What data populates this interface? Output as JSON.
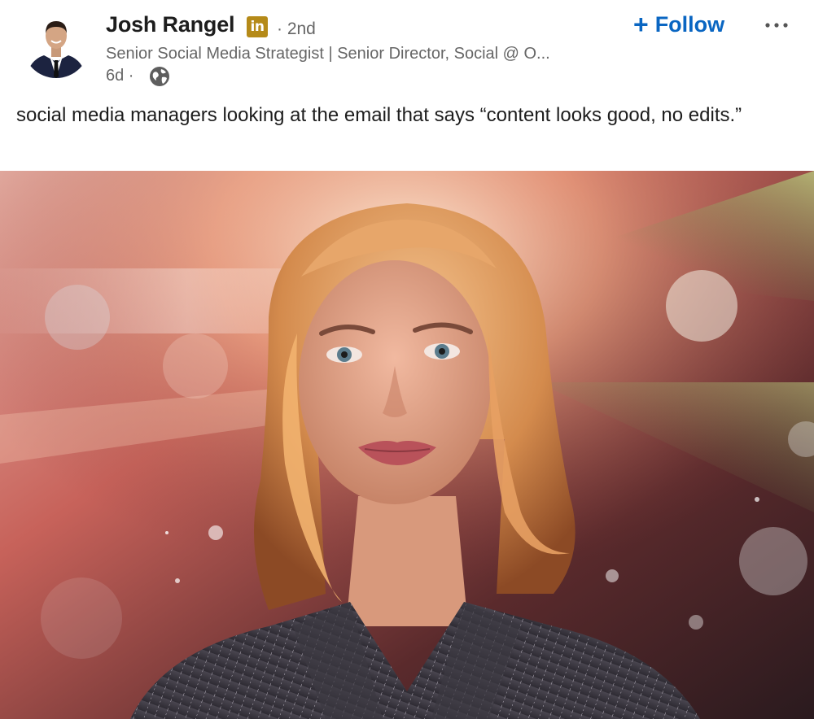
{
  "post": {
    "author": {
      "name": "Josh Rangel",
      "badge_text": "in",
      "connection_degree": "· 2nd",
      "headline": "Senior Social Media Strategist | Senior Director, Social @ O...",
      "time_ago": "6d ·",
      "visibility_icon": "globe-icon"
    },
    "follow_label": "Follow",
    "follow_icon": "plus-icon",
    "more_icon": "ellipsis-icon",
    "text": "social media managers looking at the email that says “content looks good, no edits.”",
    "colors": {
      "accent_blue": "#0a66c2",
      "badge_gold": "#b58a18",
      "secondary_text": "#666666",
      "primary_text": "#1d1d1d"
    }
  }
}
